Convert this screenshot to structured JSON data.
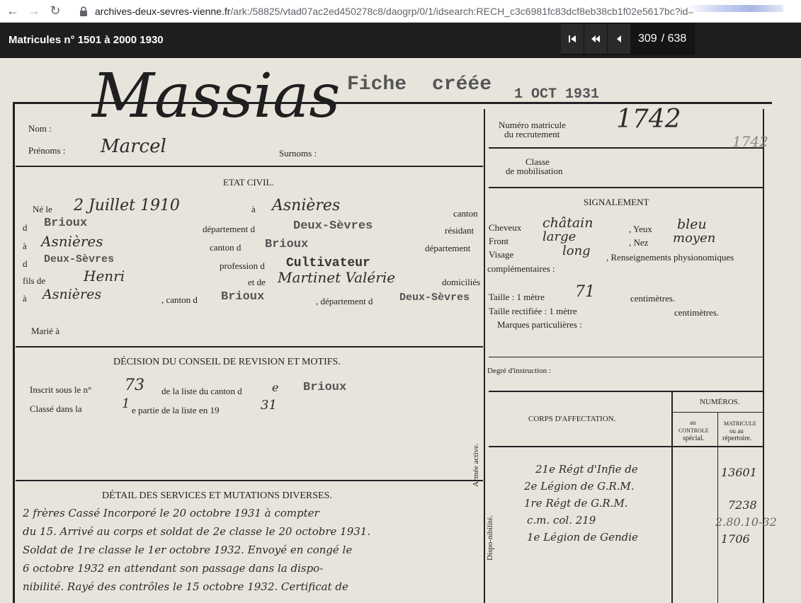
{
  "browser": {
    "url_host": "archives-deux-sevres-vienne.fr",
    "url_path": "/ark:/58825/vtad07ac2ed450278c8/daogrp/0/1/idsearch:RECH_c3c6981fc83dcf8eb38cb1f02e5617bc?id="
  },
  "viewer": {
    "title": "Matricules n° 1501 à 2000 1930",
    "current_page": "309",
    "total_pages": "/ 638"
  },
  "form": {
    "fiche_stamp": "Fiche",
    "cree_stamp": "créée",
    "date_stamp": "1 OCT 1931",
    "nom_label": "Nom :",
    "nom_value": "Massias",
    "prenoms_label": "Prénoms :",
    "prenoms_value": "Marcel",
    "surnoms_label": "Surnoms :",
    "numero_label_1": "Numéro matricule",
    "numero_label_2": "du recrutement",
    "numero_value": "1742",
    "numero_small": "1742",
    "classe_label_1": "Classe",
    "classe_label_2": "de mobilisation",
    "etat_civil": "ETAT CIVIL.",
    "ne_le": "Né le",
    "birth_date": "2 Juillet 1910",
    "a": "à",
    "birth_place": "Asnières",
    "canton": "canton",
    "d1": "d",
    "canton_value": "Brioux",
    "departement_d": "département d",
    "departement_value": "Deux-Sèvres",
    "resident": "résidant",
    "a2": "à",
    "residence": "Asnières",
    "canton_d": "canton d",
    "residence_canton": "Brioux",
    "departement": "département",
    "d2": "d",
    "residence_dept": "Deux-Sèvres",
    "profession_d": "profession d",
    "profession_value": "Cultivateur",
    "fils_de": "fils de",
    "father": "Henri",
    "et_de": "et de",
    "mother": "Martinet Valérie",
    "domicilies": "domiciliés",
    "a3": "à",
    "domicile": "Asnières",
    "canton_d2": ", canton d",
    "domicile_canton": "Brioux",
    "departement_d2": ", département d",
    "domicile_dept": "Deux-Sèvres",
    "marie": "Marié à",
    "signalement": "SIGNALEMENT",
    "cheveux": "Cheveux",
    "cheveux_value": "châtain",
    "yeux": ", Yeux",
    "yeux_value": "bleu",
    "front": "Front",
    "front_value": "large",
    "nez": ", Nez",
    "nez_value": "moyen",
    "visage": "Visage",
    "visage_value": "long",
    "renseignements": ", Renseignements physionomiques",
    "complementaires": "complémentaires :",
    "taille": "Taille : 1 mètre",
    "taille_value": "71",
    "centimetres": "centimètres.",
    "taille_rect": "Taille rectifiée : 1 mètre",
    "centimetres2": "centimètres.",
    "marques": "Marques particulières :",
    "degre": "Degré d'instruction :",
    "decision": "DÉCISION DU CONSEIL DE REVISION ET MOTIFS.",
    "inscrit": "Inscrit sous le n°",
    "inscrit_value": "73",
    "liste_canton": "de la liste du canton d",
    "liste_canton_value": "Brioux",
    "liste_canton_hw": "e",
    "classe_dans": "Classé dans la",
    "partie_value": "1",
    "partie": "e  partie de la liste en 19",
    "annee_value": "31",
    "numeros": "NUMÉROS.",
    "corps": "CORPS D'AFFECTATION.",
    "controle_1": "au",
    "controle_2": "CONTROLE",
    "controle_3": "spécial.",
    "matricule_1": "MATRICULE",
    "matricule_2": "ou au",
    "matricule_3": "répertoire.",
    "armee_active": "Armée active.",
    "disponibilite": "Dispo-nibilité.",
    "corps_1": "21e Régt d'Infie de",
    "corps_2": "2e Légion de G.R.M.",
    "corps_3": "1re Régt de G.R.M.",
    "corps_4": "c.m. col. 219",
    "corps_5": "1e Légion de Gendie",
    "mat_1": "13601",
    "mat_2": "7238",
    "mat_3": "1706",
    "margin_note": "2.80.10-32",
    "detail": "DÉTAIL DES SERVICES ET MUTATIONS DIVERSES.",
    "service_1": "2 frères   Cassé   Incorporé le 20 octobre 1931 à compter",
    "service_2": "du 15. Arrivé au corps et soldat de 2e classe le 20 octobre 1931.",
    "service_3": "Soldat de 1re classe le 1er octobre 1932. Envoyé en congé le",
    "service_4": "6 octobre 1932 en attendant son passage dans la dispo-",
    "service_5": "nibilité. Rayé des contrôles le 15 octobre 1932. Certificat de"
  }
}
